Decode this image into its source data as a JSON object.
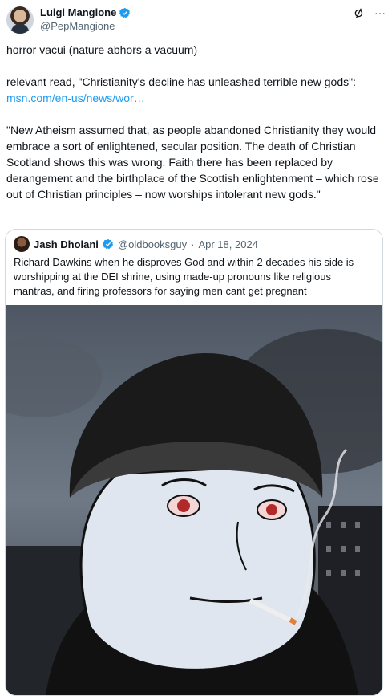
{
  "author": {
    "display_name": "Luigi Mangione",
    "handle": "@PepMangione"
  },
  "header_icons": [
    "grok-icon",
    "more-icon"
  ],
  "tweet": {
    "line1": "horror vacui (nature abhors a vacuum)",
    "line2": "relevant read, \"Christianity's decline has unleashed terrible new gods\":",
    "link": "msn.com/en-us/news/wor…",
    "quote_para": "\"New Atheism assumed that, as people abandoned Christianity they would embrace a sort of enlightened, secular position. The death of Christian Scotland shows this was wrong. Faith there has been replaced by derangement and the birthplace of the Scottish enlightenment – which rose out of Christian principles – now worships intolerant new gods.\""
  },
  "quoted_tweet": {
    "display_name": "Jash Dholani",
    "handle": "@oldbooksguy",
    "separator": "·",
    "date": "Apr 18, 2024",
    "text": "Richard Dawkins when he disproves God and within 2 decades his side is worshipping at the DEI shrine, using made-up pronouns like religious mantras, and firing professors for saying men cant get pregnant"
  },
  "colors": {
    "link": "#1d9bf0",
    "verified": "#1d9bf0",
    "secondary_text": "#536471",
    "border": "#cfd9de"
  }
}
